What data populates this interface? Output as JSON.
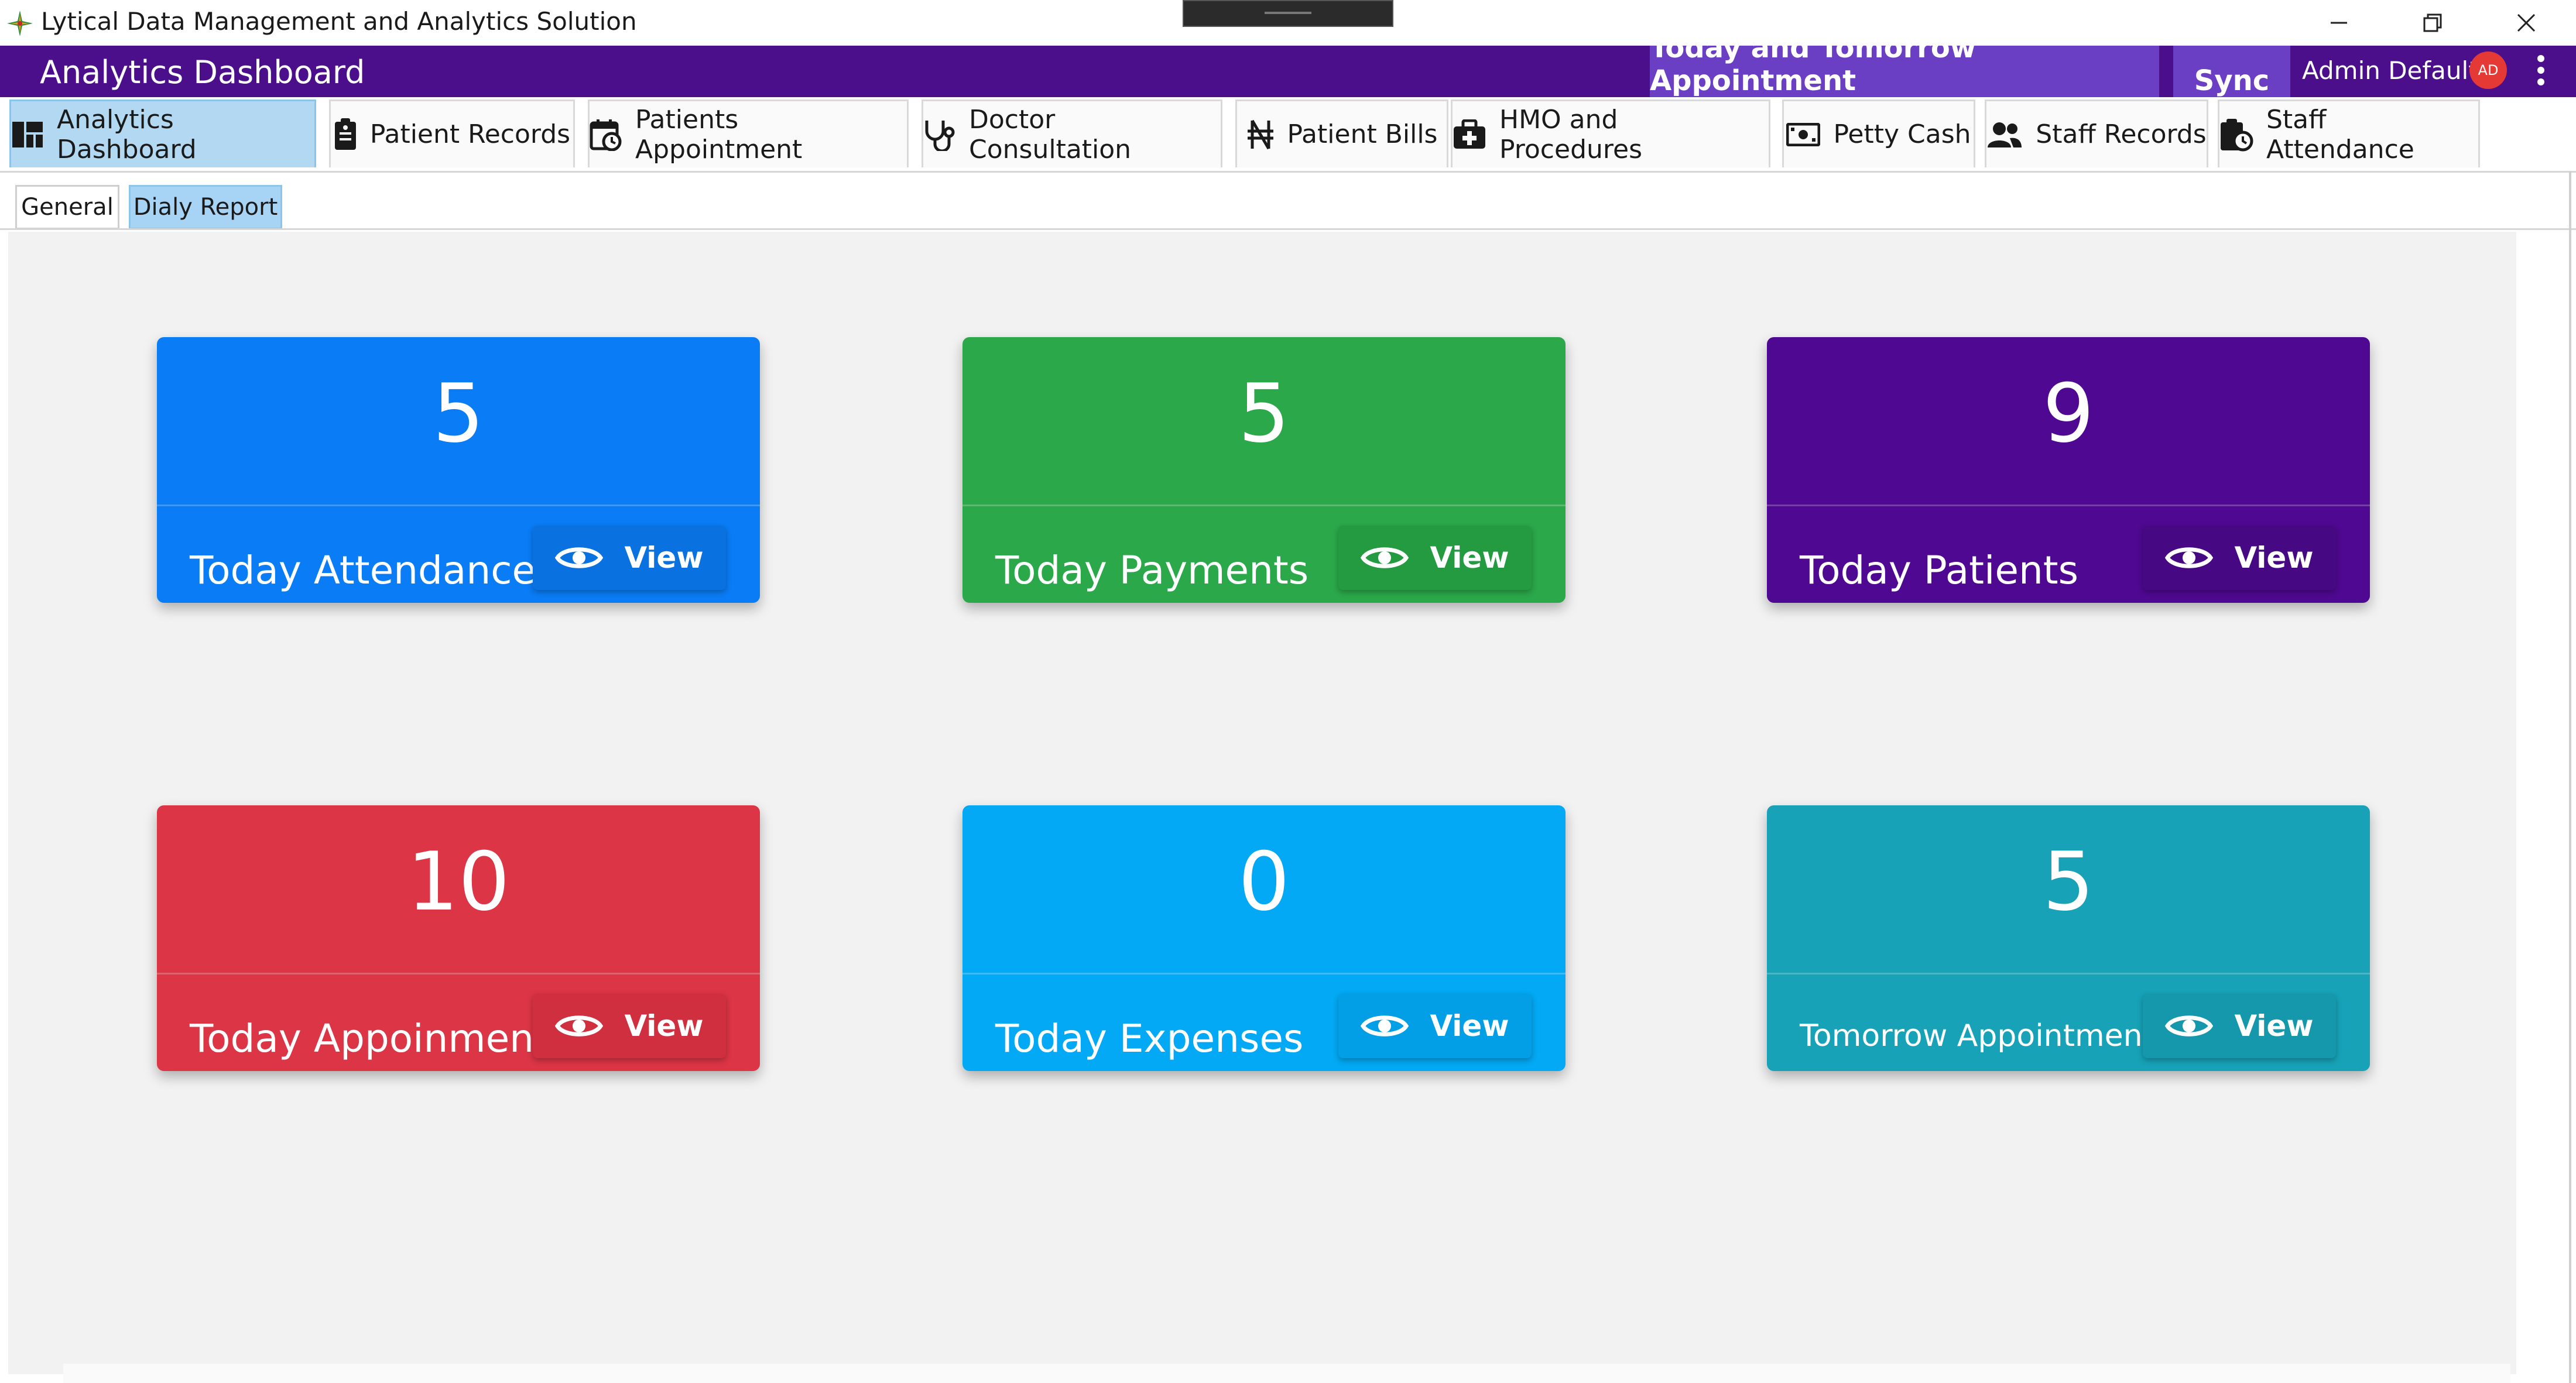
{
  "window": {
    "title": "Lytical Data Management and Analytics Solution"
  },
  "appbar": {
    "title": "Analytics Dashboard",
    "appointments_button": "Today and Tomorrow Appointment",
    "sync_button": "Sync",
    "user_name": "Admin Default",
    "avatar_initials": "AD",
    "accent_color": "#4b0f8c"
  },
  "main_tabs": [
    {
      "label": "Analytics Dashboard",
      "icon": "dashboard-icon",
      "active": true
    },
    {
      "label": "Patient Records",
      "icon": "clipboard-icon"
    },
    {
      "label": "Patients Appointment",
      "icon": "calendar-clock-icon"
    },
    {
      "label": "Doctor Consultation",
      "icon": "stethoscope-icon"
    },
    {
      "label": "Patient Bills",
      "icon": "naira-icon"
    },
    {
      "label": "HMO and Procedures",
      "icon": "medical-bag-icon"
    },
    {
      "label": "Petty Cash",
      "icon": "cash-icon"
    },
    {
      "label": "Staff Records",
      "icon": "users-icon"
    },
    {
      "label": "Staff Attendance",
      "icon": "clock-clipboard-icon"
    }
  ],
  "sub_tabs": [
    {
      "label": "General"
    },
    {
      "label": "Dialy Report",
      "active": true
    }
  ],
  "cards": [
    {
      "value": "5",
      "label": "Today Attendance",
      "button": "View",
      "color": "#0a7cf5",
      "button_color": "#0a72e0"
    },
    {
      "value": "5",
      "label": "Today Payments",
      "button": "View",
      "color": "#2ba84a",
      "button_color": "#249a41"
    },
    {
      "value": "9",
      "label": "Today Patients",
      "button": "View",
      "color": "#4f0891",
      "button_color": "#470883"
    },
    {
      "value": "10",
      "label": "Today Appoinments",
      "button": "View",
      "color": "#dc3545",
      "button_color": "#cf2f3f"
    },
    {
      "value": "0",
      "label": "Today Expenses",
      "button": "View",
      "color": "#03a9f4",
      "button_color": "#029ee6"
    },
    {
      "value": "5",
      "label": "Tomorrow Appointments",
      "button": "View",
      "color": "#17a2b8",
      "button_color": "#1597ac"
    }
  ]
}
